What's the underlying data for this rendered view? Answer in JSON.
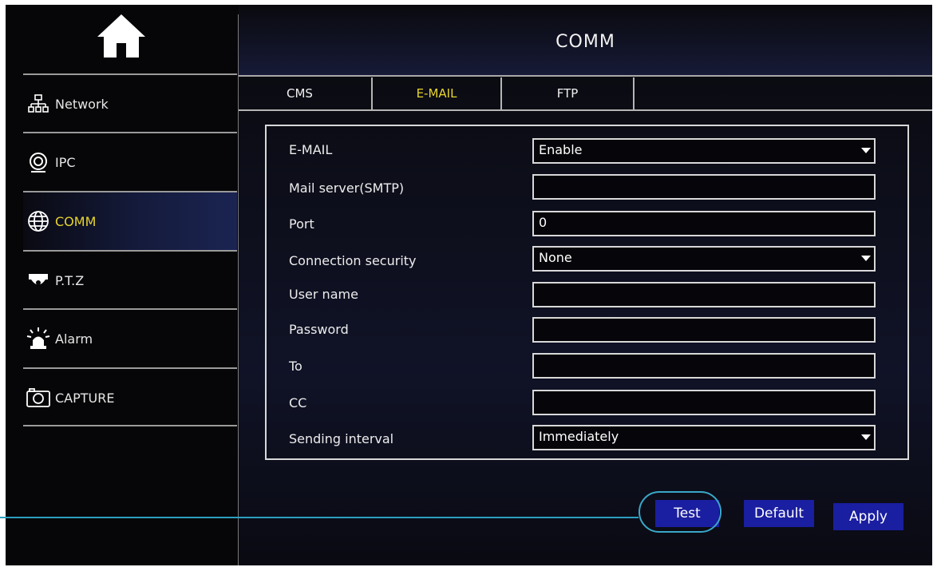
{
  "header": {
    "title": "COMM"
  },
  "sidebar": {
    "items": [
      {
        "label": "Network",
        "icon": "network-icon"
      },
      {
        "label": "IPC",
        "icon": "ipc-camera-icon"
      },
      {
        "label": "COMM",
        "icon": "globe-icon",
        "active": true
      },
      {
        "label": "P.T.Z",
        "icon": "ptz-camera-icon"
      },
      {
        "label": "Alarm",
        "icon": "alarm-light-icon"
      },
      {
        "label": "CAPTURE",
        "icon": "camera-icon"
      }
    ]
  },
  "tabs": [
    {
      "label": "CMS"
    },
    {
      "label": "E-MAIL",
      "active": true
    },
    {
      "label": "FTP"
    }
  ],
  "form": {
    "email": {
      "label": "E-MAIL",
      "value": "Enable"
    },
    "smtp": {
      "label": "Mail server(SMTP)",
      "value": ""
    },
    "port": {
      "label": "Port",
      "value": "0"
    },
    "security": {
      "label": "Connection security",
      "value": "None"
    },
    "username": {
      "label": "User name",
      "value": ""
    },
    "password": {
      "label": "Password",
      "value": ""
    },
    "to": {
      "label": "To",
      "value": ""
    },
    "cc": {
      "label": "CC",
      "value": ""
    },
    "interval": {
      "label": "Sending interval",
      "value": "Immediately"
    }
  },
  "buttons": {
    "test": "Test",
    "default": "Default",
    "apply": "Apply"
  },
  "colors": {
    "accent_text": "#e7d430",
    "button_bg": "#1a1ea0",
    "callout": "#3aa8c8"
  }
}
